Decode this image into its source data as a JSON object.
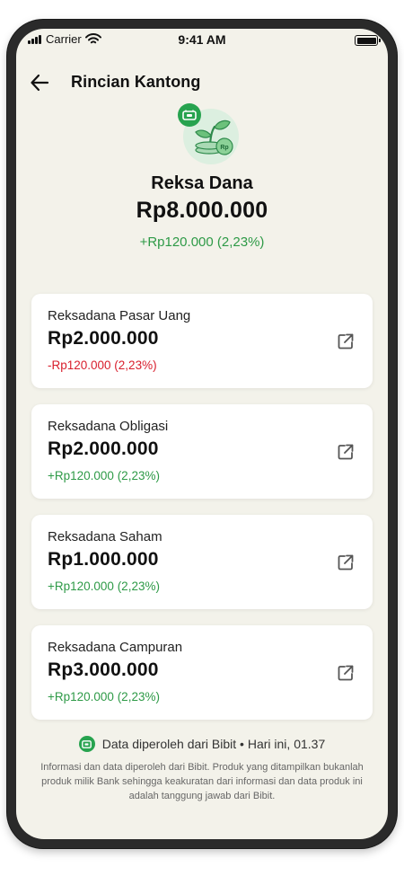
{
  "status_bar": {
    "carrier": "Carrier",
    "time": "9:41 AM"
  },
  "header": {
    "title": "Rincian Kantong",
    "back_icon": "arrow-left-icon"
  },
  "summary": {
    "illustration": "money-plant-icon",
    "badge": "bibit-badge-icon",
    "name": "Reksa Dana",
    "total": "Rp8.000.000",
    "change": "+Rp120.000 (2,23%)"
  },
  "funds": [
    {
      "name": "Reksadana Pasar Uang",
      "amount": "Rp2.000.000",
      "change": "-Rp120.000 (2,23%)",
      "trend": "negative"
    },
    {
      "name": "Reksadana Obligasi",
      "amount": "Rp2.000.000",
      "change": "+Rp120.000 (2,23%)",
      "trend": "positive"
    },
    {
      "name": "Reksadana Saham",
      "amount": "Rp1.000.000",
      "change": "+Rp120.000 (2,23%)",
      "trend": "positive"
    },
    {
      "name": "Reksadana Campuran",
      "amount": "Rp3.000.000",
      "change": "+Rp120.000 (2,23%)",
      "trend": "positive"
    }
  ],
  "source": {
    "text": "Data diperoleh dari Bibit • Hari ini, 01.37",
    "icon": "bibit-logo-icon"
  },
  "disclaimer": "Informasi dan data diperoleh dari Bibit. Produk yang ditampilkan bukanlah produk milik Bank sehingga keakuratan dari informasi dan data produk ini adalah tanggung jawab dari Bibit.",
  "colors": {
    "background": "#f3f2ea",
    "positive": "#2e9a47",
    "negative": "#d81e2c",
    "brand": "#27a34f"
  }
}
